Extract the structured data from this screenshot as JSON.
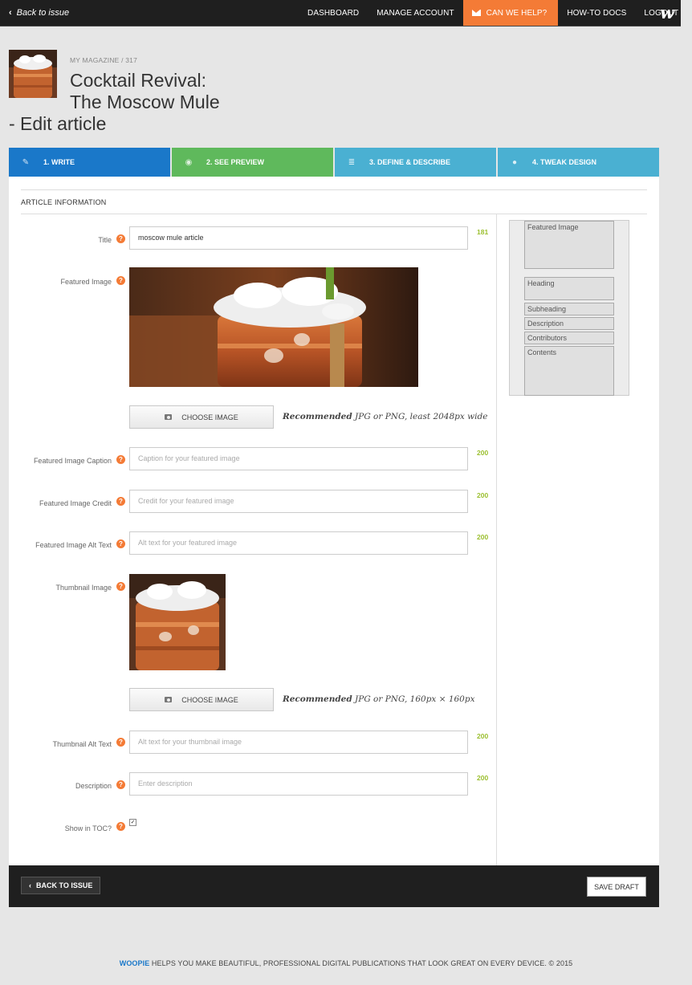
{
  "topnav": {
    "back_label": "Back to issue",
    "links": [
      "DASHBOARD",
      "MANAGE ACCOUNT",
      "CAN WE HELP?",
      "HOW-TO DOCS",
      "LOGOUT"
    ],
    "logo": "w",
    "help_color": "#f47b36"
  },
  "header": {
    "breadcrumb": "MY MAGAZINE / 317",
    "title_line1": "Cocktail Revival:",
    "title_line2": "The Moscow Mule",
    "title_line3": "- Edit article"
  },
  "steps": [
    {
      "label": "1. WRITE",
      "icon": "pencil-icon",
      "color": "#1a78c9"
    },
    {
      "label": "2. SEE PREVIEW",
      "icon": "eye-icon",
      "color": "#5fb95c"
    },
    {
      "label": "3. DEFINE & DESCRIBE",
      "icon": "list-icon",
      "color": "#4ab0d2"
    },
    {
      "label": "4. TWEAK DESIGN",
      "icon": "drop-icon",
      "color": "#4ab0d2"
    }
  ],
  "section": {
    "title": "ARTICLE INFORMATION"
  },
  "form": {
    "title": {
      "label": "Title",
      "value": "moscow mule article",
      "count": "181"
    },
    "featured_image": {
      "label": "Featured Image",
      "button": "CHOOSE IMAGE",
      "rec_bold": "Recommended",
      "rec_text": "JPG or PNG, least 2048px wide"
    },
    "caption": {
      "label": "Featured Image Caption",
      "placeholder": "Caption for your featured image",
      "count": "200"
    },
    "credit": {
      "label": "Featured Image Credit",
      "placeholder": "Credit for your featured image",
      "count": "200"
    },
    "alt": {
      "label": "Featured Image Alt Text",
      "placeholder": "Alt text for your featured image",
      "count": "200"
    },
    "thumbnail": {
      "label": "Thumbnail Image",
      "button": "CHOOSE IMAGE",
      "rec_bold": "Recommended",
      "rec_text": "JPG or PNG, 160px × 160px"
    },
    "thumb_alt": {
      "label": "Thumbnail Alt Text",
      "placeholder": "Alt text for your thumbnail image",
      "count": "200"
    },
    "description": {
      "label": "Description",
      "placeholder": "Enter description",
      "count": "200"
    },
    "toc": {
      "label": "Show in TOC?",
      "checked": true
    }
  },
  "layout_preview": [
    "Featured Image",
    "Heading",
    "Subheading",
    "Description",
    "Contributors",
    "Contents"
  ],
  "bottom": {
    "back_label": "BACK TO ISSUE",
    "save_label": "SAVE DRAFT"
  },
  "footer": {
    "brand": "WOOPIE",
    "text": " HELPS YOU MAKE BEAUTIFUL, PROFESSIONAL DIGITAL PUBLICATIONS THAT LOOK GREAT ON EVERY DEVICE. © 2015"
  }
}
